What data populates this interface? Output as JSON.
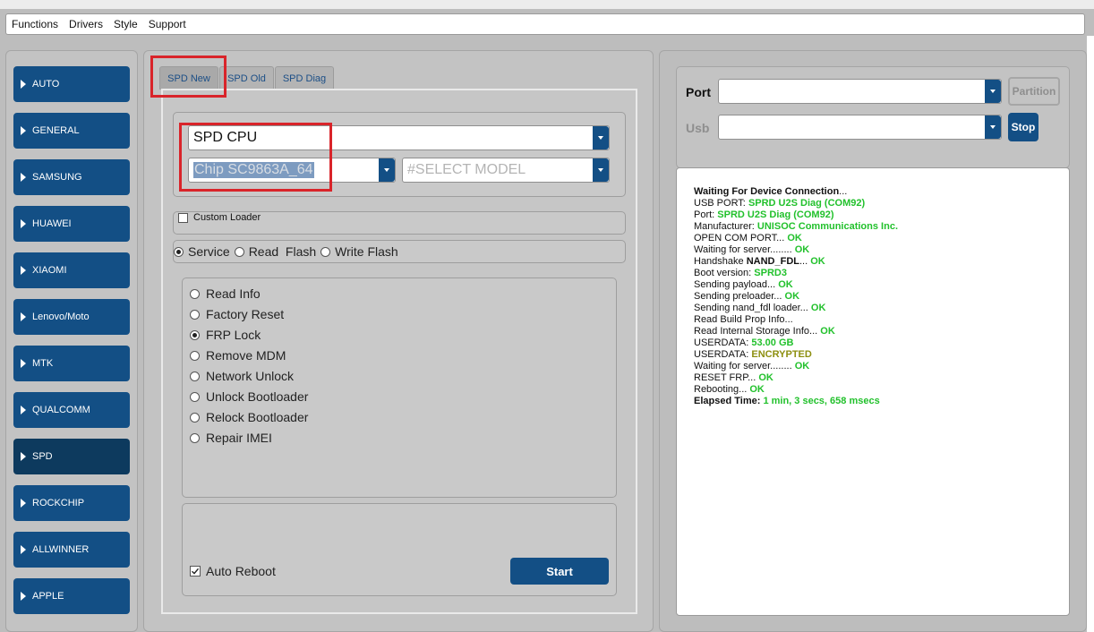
{
  "menu": [
    "Functions",
    "Drivers",
    "Style",
    "Support"
  ],
  "sidebar": {
    "items": [
      {
        "label": "AUTO"
      },
      {
        "label": "GENERAL"
      },
      {
        "label": "SAMSUNG"
      },
      {
        "label": "HUAWEI"
      },
      {
        "label": "XIAOMI"
      },
      {
        "label": "Lenovo/Moto"
      },
      {
        "label": "MTK"
      },
      {
        "label": "QUALCOMM"
      },
      {
        "label": "SPD",
        "active": true
      },
      {
        "label": "ROCKCHIP"
      },
      {
        "label": "ALLWINNER"
      },
      {
        "label": "APPLE"
      }
    ]
  },
  "tabs": [
    {
      "label": "SPD New",
      "active": true
    },
    {
      "label": "SPD Old"
    },
    {
      "label": "SPD Diag"
    }
  ],
  "cpu_select": {
    "value": "SPD CPU"
  },
  "chip_select": {
    "value": "Chip SC9863A_64"
  },
  "model_select": {
    "placeholder": "#SELECT MODEL"
  },
  "custom_loader": {
    "label": "Custom Loader",
    "checked": false
  },
  "modes": [
    {
      "label": "Service",
      "selected": true
    },
    {
      "label": "Read  Flash",
      "selected": false
    },
    {
      "label": "Write Flash",
      "selected": false
    }
  ],
  "operations": [
    {
      "label": "Read Info",
      "selected": false
    },
    {
      "label": "Factory Reset",
      "selected": false
    },
    {
      "label": "FRP Lock",
      "selected": true
    },
    {
      "label": "Remove MDM",
      "selected": false
    },
    {
      "label": "Network Unlock",
      "selected": false
    },
    {
      "label": "Unlock Bootloader",
      "selected": false
    },
    {
      "label": "Relock Bootloader",
      "selected": false
    },
    {
      "label": "Repair IMEI",
      "selected": false
    }
  ],
  "auto_reboot": {
    "label": "Auto Reboot",
    "checked": true
  },
  "start_button": {
    "label": "Start"
  },
  "port": {
    "label": "Port",
    "value": ""
  },
  "usb": {
    "label": "Usb",
    "value": ""
  },
  "partition_button": {
    "label": "Partition"
  },
  "stop_button": {
    "label": "Stop"
  },
  "log": [
    {
      "parts": [
        {
          "t": "Waiting For Device Connection",
          "s": "b"
        },
        {
          "t": "...",
          "s": ""
        }
      ]
    },
    {
      "parts": [
        {
          "t": "USB PORT: ",
          "s": ""
        },
        {
          "t": "SPRD U2S Diag (COM92)",
          "s": "g"
        }
      ]
    },
    {
      "parts": [
        {
          "t": "Port: ",
          "s": ""
        },
        {
          "t": "SPRD U2S Diag (COM92)",
          "s": "g"
        }
      ]
    },
    {
      "parts": [
        {
          "t": "Manufacturer: ",
          "s": ""
        },
        {
          "t": "UNISOC Communications Inc.",
          "s": "g"
        }
      ]
    },
    {
      "parts": [
        {
          "t": "OPEN COM PORT... ",
          "s": ""
        },
        {
          "t": "OK",
          "s": "g"
        }
      ]
    },
    {
      "parts": [
        {
          "t": "Waiting for server........ ",
          "s": ""
        },
        {
          "t": "OK",
          "s": "g"
        }
      ]
    },
    {
      "parts": [
        {
          "t": "Handshake ",
          "s": ""
        },
        {
          "t": "NAND_FDL",
          "s": "b"
        },
        {
          "t": "... ",
          "s": ""
        },
        {
          "t": "OK",
          "s": "g"
        }
      ]
    },
    {
      "parts": [
        {
          "t": "Boot version: ",
          "s": ""
        },
        {
          "t": "SPRD3",
          "s": "g"
        }
      ]
    },
    {
      "parts": [
        {
          "t": "Sending payload... ",
          "s": ""
        },
        {
          "t": "OK",
          "s": "g"
        }
      ]
    },
    {
      "parts": [
        {
          "t": "Sending preloader... ",
          "s": ""
        },
        {
          "t": "OK",
          "s": "g"
        }
      ]
    },
    {
      "parts": [
        {
          "t": "Sending nand_fdl loader... ",
          "s": ""
        },
        {
          "t": "OK",
          "s": "g"
        }
      ]
    },
    {
      "parts": [
        {
          "t": "Read Build Prop Info...",
          "s": ""
        }
      ]
    },
    {
      "parts": [
        {
          "t": "Read Internal Storage Info... ",
          "s": ""
        },
        {
          "t": "OK",
          "s": "g"
        }
      ]
    },
    {
      "parts": [
        {
          "t": "USERDATA: ",
          "s": ""
        },
        {
          "t": "53.00 GB",
          "s": "g"
        }
      ]
    },
    {
      "parts": [
        {
          "t": "USERDATA: ",
          "s": ""
        },
        {
          "t": "ENCRYPTED",
          "s": "o"
        }
      ]
    },
    {
      "parts": [
        {
          "t": "Waiting for server........ ",
          "s": ""
        },
        {
          "t": "OK",
          "s": "g"
        }
      ]
    },
    {
      "parts": [
        {
          "t": "RESET FRP... ",
          "s": ""
        },
        {
          "t": "OK",
          "s": "g"
        }
      ]
    },
    {
      "parts": [
        {
          "t": "Rebooting... ",
          "s": ""
        },
        {
          "t": "OK",
          "s": "g"
        }
      ]
    },
    {
      "parts": [
        {
          "t": "Elapsed Time: ",
          "s": "b"
        },
        {
          "t": "1 min, 3 secs, 658 msecs",
          "s": "g"
        }
      ]
    }
  ],
  "colors": {
    "accent": "#134f85",
    "ok_green": "#22c12c",
    "warning_olive": "#8d8f10",
    "highlight_red": "#d9242a"
  }
}
